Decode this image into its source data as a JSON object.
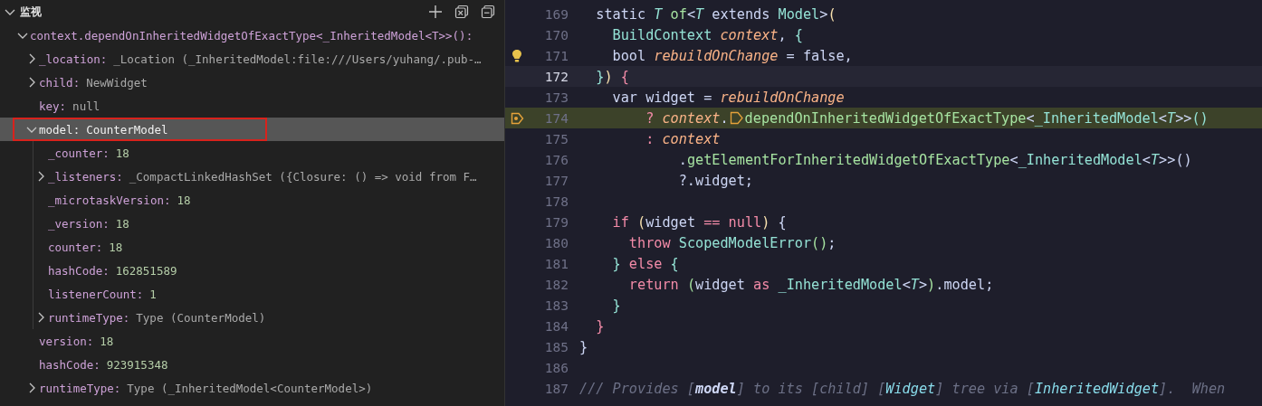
{
  "watch_panel": {
    "title": "监视",
    "expanded": true,
    "items": [
      {
        "name": "context.dependOnInheritedWidgetOfExactType<_InheritedModel<T>>():",
        "expanded": true,
        "selected": false,
        "children": [
          {
            "name": "_location:",
            "value": "_Location (_InheritedModel:file:///Users/yuhang/.pub-…",
            "kind": "object",
            "expanded": false,
            "selected": false
          },
          {
            "name": "child:",
            "value": "NewWidget",
            "kind": "object",
            "expanded": false,
            "selected": false
          },
          {
            "name": "key:",
            "value": "null",
            "kind": "object",
            "selected": false
          },
          {
            "name": "model:",
            "value": "CounterModel",
            "kind": "object",
            "expanded": true,
            "selected": true,
            "children": [
              {
                "name": "_counter:",
                "value": "18",
                "kind": "number",
                "selected": false
              },
              {
                "name": "_listeners:",
                "value": "_CompactLinkedHashSet ({Closure: () => void from F…",
                "kind": "object",
                "expanded": false,
                "selected": false
              },
              {
                "name": "_microtaskVersion:",
                "value": "18",
                "kind": "number",
                "selected": false
              },
              {
                "name": "_version:",
                "value": "18",
                "kind": "number",
                "selected": false
              },
              {
                "name": "counter:",
                "value": "18",
                "kind": "number",
                "selected": false
              },
              {
                "name": "hashCode:",
                "value": "162851589",
                "kind": "number",
                "selected": false
              },
              {
                "name": "listenerCount:",
                "value": "1",
                "kind": "number",
                "selected": false
              },
              {
                "name": "runtimeType:",
                "value": "Type (CounterModel)",
                "kind": "object",
                "expanded": false,
                "selected": false
              }
            ]
          },
          {
            "name": "version:",
            "value": "18",
            "kind": "number",
            "selected": false
          },
          {
            "name": "hashCode:",
            "value": "923915348",
            "kind": "number",
            "selected": false
          },
          {
            "name": "runtimeType:",
            "value": "Type (_InheritedModel<CounterModel>)",
            "kind": "object",
            "expanded": false,
            "selected": false
          }
        ]
      }
    ]
  },
  "editor": {
    "lines": [
      {
        "number": "169",
        "current": false,
        "paused": false,
        "tokens": [
          {
            "kind": "plain",
            "text": "  static "
          },
          {
            "kind": "typeparam",
            "text": "T"
          },
          {
            "kind": "function",
            "text": " of"
          },
          {
            "kind": "plain",
            "text": "<"
          },
          {
            "kind": "typeparam",
            "text": "T"
          },
          {
            "kind": "plain",
            "text": " extends "
          },
          {
            "kind": "type",
            "text": "Model"
          },
          {
            "kind": "plain",
            "text": ">"
          },
          {
            "kind": "bracket",
            "text": "("
          }
        ]
      },
      {
        "number": "170",
        "current": false,
        "paused": false,
        "tokens": [
          {
            "kind": "type",
            "text": "    BuildContext "
          },
          {
            "kind": "param",
            "text": "context"
          },
          {
            "kind": "plain",
            "text": ", "
          },
          {
            "kind": "brace",
            "text": "{"
          }
        ]
      },
      {
        "number": "171",
        "current": false,
        "paused": false,
        "hint": true,
        "tokens": [
          {
            "kind": "plain",
            "text": "    bool "
          },
          {
            "kind": "param",
            "text": "rebuildOnChange"
          },
          {
            "kind": "plain",
            "text": " = false,"
          }
        ]
      },
      {
        "number": "172",
        "current": true,
        "paused": false,
        "tokens": [
          {
            "kind": "brace",
            "text": "  }"
          },
          {
            "kind": "bracket",
            "text": ") "
          },
          {
            "kind": "keyword",
            "text": "{"
          }
        ]
      },
      {
        "number": "173",
        "current": false,
        "paused": false,
        "tokens": [
          {
            "kind": "plain",
            "text": "    var widget = "
          },
          {
            "kind": "param",
            "text": "rebuildOnChange"
          }
        ]
      },
      {
        "number": "174",
        "current": false,
        "paused": true,
        "breakpoint": true,
        "tokens": [
          {
            "kind": "keyword",
            "text": "        ? "
          },
          {
            "kind": "param",
            "text": "context"
          },
          {
            "kind": "plain",
            "text": "."
          },
          {
            "kind": "marker"
          },
          {
            "kind": "function",
            "text": "dependOnInheritedWidgetOfExactType"
          },
          {
            "kind": "plain",
            "text": "<"
          },
          {
            "kind": "type",
            "text": "_InheritedModel"
          },
          {
            "kind": "plain",
            "text": "<"
          },
          {
            "kind": "typeparam",
            "text": "T"
          },
          {
            "kind": "plain",
            "text": ">>"
          },
          {
            "kind": "brace",
            "text": "()"
          }
        ]
      },
      {
        "number": "175",
        "current": false,
        "paused": false,
        "tokens": [
          {
            "kind": "keyword",
            "text": "        : "
          },
          {
            "kind": "param",
            "text": "context"
          }
        ]
      },
      {
        "number": "176",
        "current": false,
        "paused": false,
        "tokens": [
          {
            "kind": "plain",
            "text": "            ."
          },
          {
            "kind": "function",
            "text": "getElementForInheritedWidgetOfExactType"
          },
          {
            "kind": "plain",
            "text": "<"
          },
          {
            "kind": "type",
            "text": "_InheritedModel"
          },
          {
            "kind": "plain",
            "text": "<"
          },
          {
            "kind": "typeparam",
            "text": "T"
          },
          {
            "kind": "plain",
            "text": ">>()"
          }
        ]
      },
      {
        "number": "177",
        "current": false,
        "paused": false,
        "tokens": [
          {
            "kind": "plain",
            "text": "            ?.widget;"
          }
        ]
      },
      {
        "number": "178",
        "current": false,
        "paused": false
      },
      {
        "number": "179",
        "current": false,
        "paused": false,
        "tokens": [
          {
            "kind": "keyword",
            "text": "    if "
          },
          {
            "kind": "bracket",
            "text": "("
          },
          {
            "kind": "plain",
            "text": "widget "
          },
          {
            "kind": "keyword",
            "text": "== null"
          },
          {
            "kind": "bracket",
            "text": ")"
          },
          {
            "kind": "plain",
            "text": " {"
          }
        ]
      },
      {
        "number": "180",
        "current": false,
        "paused": false,
        "tokens": [
          {
            "kind": "keyword",
            "text": "      throw "
          },
          {
            "kind": "type",
            "text": "ScopedModelError"
          },
          {
            "kind": "function",
            "text": "()"
          },
          {
            "kind": "plain",
            "text": ";"
          }
        ]
      },
      {
        "number": "181",
        "current": false,
        "paused": false,
        "tokens": [
          {
            "kind": "brace",
            "text": "    }"
          },
          {
            "kind": "keyword",
            "text": " else "
          },
          {
            "kind": "brace",
            "text": "{"
          }
        ]
      },
      {
        "number": "182",
        "current": false,
        "paused": false,
        "tokens": [
          {
            "kind": "keyword",
            "text": "      return "
          },
          {
            "kind": "function",
            "text": "("
          },
          {
            "kind": "plain",
            "text": "widget "
          },
          {
            "kind": "keyword",
            "text": "as "
          },
          {
            "kind": "type",
            "text": "_InheritedModel"
          },
          {
            "kind": "plain",
            "text": "<"
          },
          {
            "kind": "typeparam",
            "text": "T"
          },
          {
            "kind": "plain",
            "text": ">"
          },
          {
            "kind": "function",
            "text": ")"
          },
          {
            "kind": "plain",
            "text": ".model;"
          }
        ]
      },
      {
        "number": "183",
        "current": false,
        "paused": false,
        "tokens": [
          {
            "kind": "brace",
            "text": "    }"
          }
        ]
      },
      {
        "number": "184",
        "current": false,
        "paused": false,
        "tokens": [
          {
            "kind": "keyword",
            "text": "  }"
          }
        ]
      },
      {
        "number": "185",
        "current": false,
        "paused": false,
        "tokens": [
          {
            "kind": "plain",
            "text": "}"
          }
        ]
      },
      {
        "number": "186",
        "current": false,
        "paused": false
      },
      {
        "number": "187",
        "current": false,
        "paused": false,
        "tokens": [
          {
            "kind": "comment",
            "text": "/// Provides ["
          },
          {
            "kind": "commentref",
            "text": "model"
          },
          {
            "kind": "comment",
            "text": "] to its ["
          },
          {
            "kind": "commentitalic",
            "text": "child"
          },
          {
            "kind": "comment",
            "text": "] ["
          },
          {
            "kind": "commenttype",
            "text": "Widget"
          },
          {
            "kind": "comment",
            "text": "] tree via ["
          },
          {
            "kind": "commenttype",
            "text": "InheritedWidget"
          },
          {
            "kind": "comment",
            "text": "].  When"
          }
        ]
      }
    ]
  }
}
